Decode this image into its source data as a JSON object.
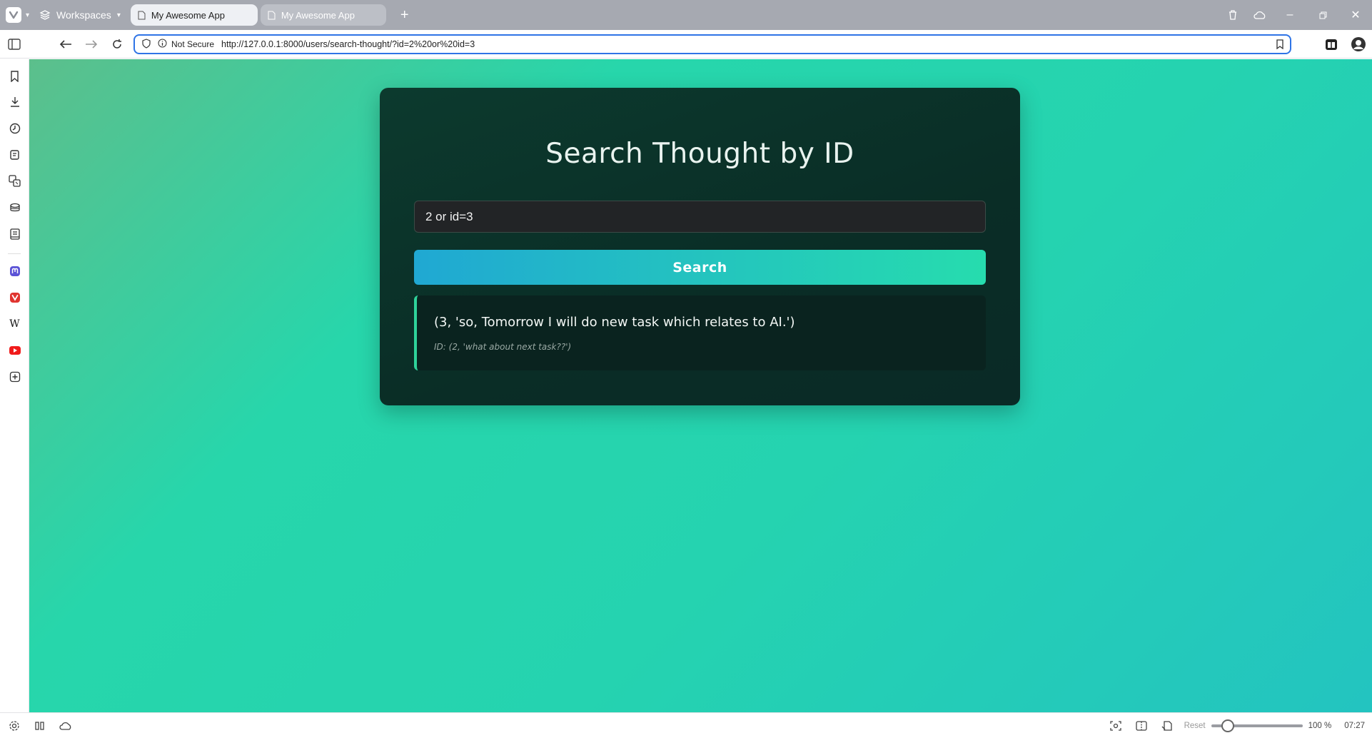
{
  "browser": {
    "workspaces_label": "Workspaces",
    "tabs": [
      {
        "title": "My Awesome App",
        "active": true
      },
      {
        "title": "My Awesome App",
        "active": false
      }
    ],
    "security_label": "Not Secure",
    "url": "http://127.0.0.1:8000/users/search-thought/?id=2%20or%20id=3"
  },
  "page": {
    "heading": "Search Thought by ID",
    "search_input_value": "2 or id=3",
    "search_button_label": "Search",
    "result": {
      "main_text": "(3, 'so, Tomorrow I will do new task which relates to AI.')",
      "sub_text": "ID: (2, 'what about next task??')"
    }
  },
  "statusbar": {
    "reset_label": "Reset",
    "zoom_label": "100 %",
    "zoom_percent": 100,
    "clock": "07:27"
  }
}
